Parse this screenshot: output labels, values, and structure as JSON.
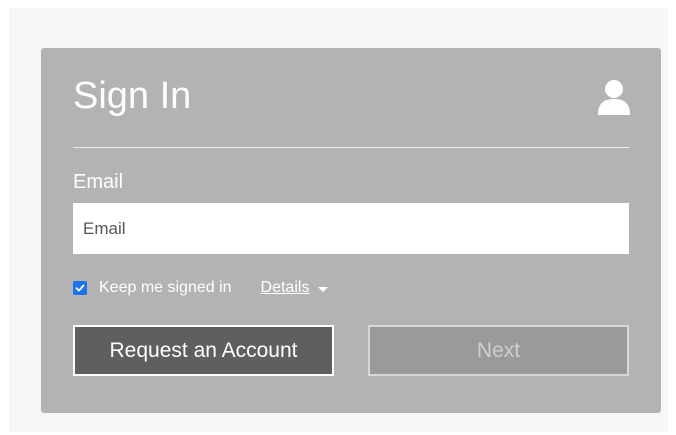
{
  "signin": {
    "title": "Sign In",
    "email_label": "Email",
    "email_value": "",
    "email_placeholder": "Email",
    "keep_signed_in": {
      "label": "Keep me signed in",
      "checked": true
    },
    "details_link": "Details",
    "request_button": "Request an Account",
    "next_button": "Next"
  },
  "icons": {
    "user": "user-icon",
    "check": "check-icon",
    "caret": "caret-down-icon"
  },
  "colors": {
    "card_background": "#b3b3b3",
    "checkbox_accent": "#1a73e8",
    "request_button_bg": "#5f5f5f",
    "next_button_bg": "#9a9a9a"
  }
}
